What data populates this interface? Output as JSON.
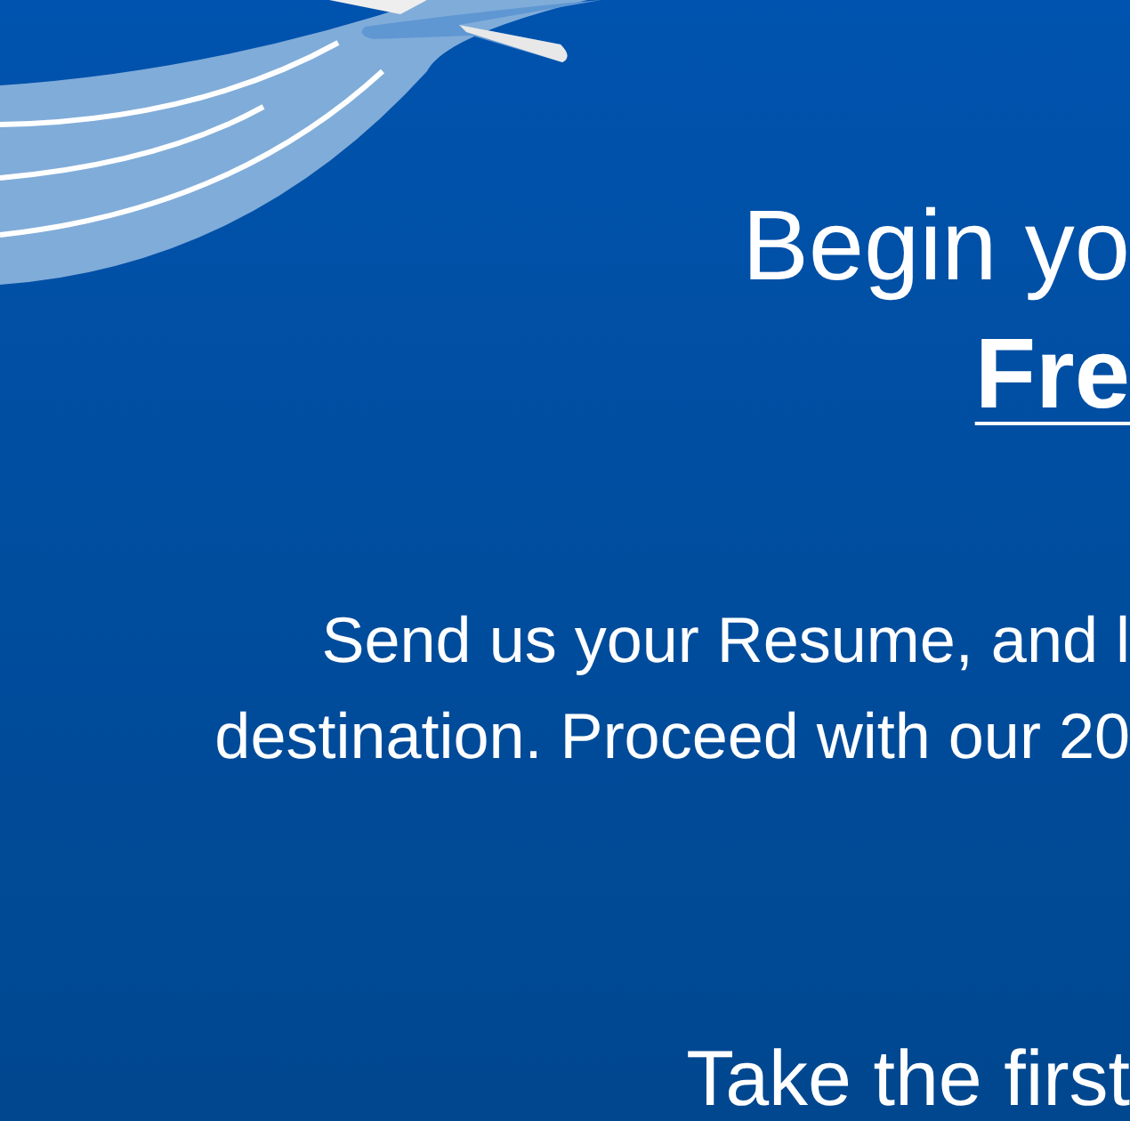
{
  "hero": {
    "heading": "Begin yo",
    "subheading": "Fre",
    "description": [
      "Send us your Resume, and l",
      "destination. Proceed with our 20"
    ],
    "call_to_action": "Take the first"
  }
}
